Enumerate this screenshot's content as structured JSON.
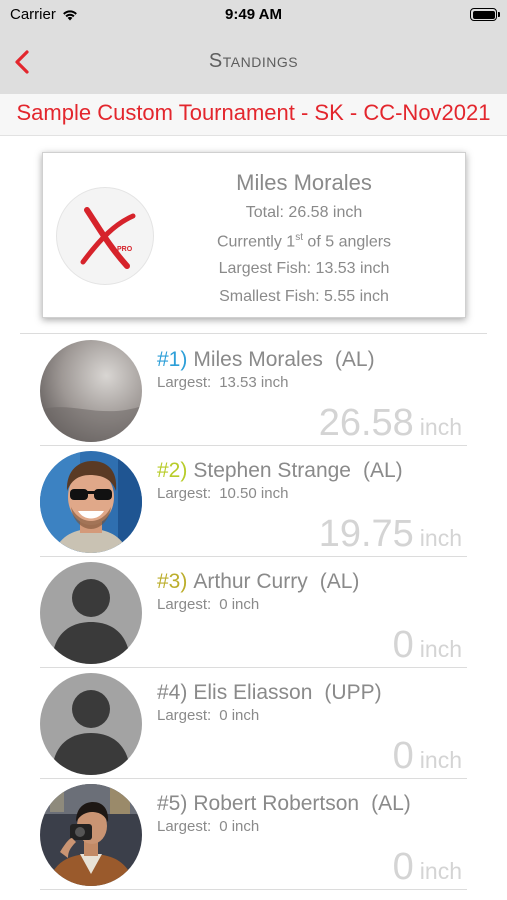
{
  "status_bar": {
    "carrier": "Carrier",
    "time": "9:49 AM"
  },
  "nav": {
    "title": "Standings",
    "back_icon": "chevron-left-icon"
  },
  "tournament": {
    "name": "Sample Custom Tournament - SK - CC-Nov2021"
  },
  "summary": {
    "name": "Miles Morales",
    "total": "Total: 26.58 inch",
    "standing_prefix": "Currently 1",
    "standing_sup": "st",
    "standing_suffix": " of 5 anglers",
    "largest": "Largest Fish:  13.53 inch",
    "smallest": "Smallest Fish:  5.55 inch"
  },
  "standings": [
    {
      "rank": "#1)",
      "rank_color": "#2d9fd8",
      "name": "Miles Morales",
      "club": "(AL)",
      "largest_label": "Largest:",
      "largest_value": "13.53 inch",
      "total": "26.58",
      "unit": "inch",
      "avatar": "photo-placeholder"
    },
    {
      "rank": "#2)",
      "rank_color": "#b8cc2a",
      "name": "Stephen Strange",
      "club": "(AL)",
      "largest_label": "Largest:",
      "largest_value": "10.50 inch",
      "total": "19.75",
      "unit": "inch",
      "avatar": "photo-man-sunglasses"
    },
    {
      "rank": "#3)",
      "rank_color": "#bcae2c",
      "name": "Arthur Curry",
      "club": "(AL)",
      "largest_label": "Largest:",
      "largest_value": "0 inch",
      "total": "0",
      "unit": "inch",
      "avatar": "default-person"
    },
    {
      "rank": "#4)",
      "rank_color": "#8a8a8a",
      "name": "Elis Eliasson",
      "club": "(UPP)",
      "largest_label": "Largest:",
      "largest_value": "0 inch",
      "total": "0",
      "unit": "inch",
      "avatar": "default-person"
    },
    {
      "rank": "#5)",
      "rank_color": "#8a8a8a",
      "name": "Robert Robertson",
      "club": "(AL)",
      "largest_label": "Largest:",
      "largest_value": "0 inch",
      "total": "0",
      "unit": "inch",
      "avatar": "photo-man-camera"
    }
  ],
  "colors": {
    "accent_red": "#e3262d",
    "nav_background": "#dedede",
    "total_gray": "#d4d4d4"
  }
}
